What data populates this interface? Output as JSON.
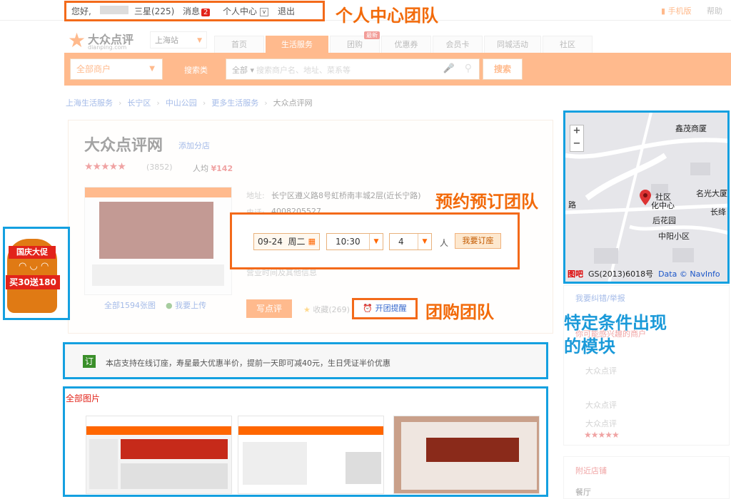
{
  "topbar": {
    "greeting": "您好,",
    "username": "       ",
    "level": "三星(225)",
    "messages_label": "消息",
    "messages_count": "2",
    "user_center": "个人中心",
    "logout": "退出",
    "mobile": "手机版",
    "help": "帮助"
  },
  "header": {
    "logo_text": "大众点评",
    "logo_sub": "dianping.com",
    "city": "上海站",
    "tabs": [
      "首页",
      "生活服务",
      "团购",
      "优惠券",
      "会员卡",
      "同城活动",
      "社区"
    ],
    "new_badge": "最新",
    "category_select": "全部商户",
    "category_label": "搜索类",
    "search_scope": "全部",
    "search_placeholder": "搜索商户名、地址、菜系等",
    "search_button": "搜索"
  },
  "breadcrumb": [
    "上海生活服务",
    "长宁区",
    "中山公园",
    "更多生活服务",
    "大众点评网"
  ],
  "shop": {
    "name": "大众点评网",
    "name_link": "添加分店",
    "stars": "★★★★★",
    "reviews": "(3852)",
    "avg_label": "人均",
    "avg_value": "¥142",
    "addr_label": "地址:",
    "addr_value": "长宁区遵义路8号虹桥南丰城2层(近长宁路)",
    "tel_label": "电话:",
    "tel_value": "4008205527",
    "more_info": "营业时间及其他信息",
    "review_button": "写点评",
    "fav": "收藏(269)",
    "photo_count": "全部1594张图",
    "upload_photo": "我要上传"
  },
  "booking": {
    "date": "09-24",
    "weekday": "周二",
    "time": "10:30",
    "people": "4",
    "people_unit": "人",
    "button": "我要订座"
  },
  "groupbuy": {
    "button": "开团提醒"
  },
  "annotations": {
    "user_center_team": "个人中心团队",
    "booking_team": "预约预订团队",
    "groupbuy_team": "团购团队",
    "conditional_modules_line1": "特定条件出现",
    "conditional_modules_line2": "的模块"
  },
  "notice": {
    "icon": "订",
    "text": "本店支持在线订座，寿星最大优惠半价，提前一天即可减40元，生日凭证半价优惠"
  },
  "photos": {
    "title": "全部图片"
  },
  "promo": {
    "line1": "国庆大促",
    "line2": "买30送180"
  },
  "map": {
    "labels": [
      "鑫茂商厦",
      "社区",
      "化中心",
      "后花园",
      "名光大厦",
      "长绛",
      "中阳小区",
      "路"
    ],
    "copyright": "GS(2013)6018号",
    "data_label": "Data ©",
    "navinfo": "NavInfo",
    "baidu": "图吧",
    "zoom_in": "+",
    "zoom_out": "−"
  },
  "right_column": {
    "report": "我要纠错/举报",
    "lines": [
      "你可能感兴趣的商户",
      "大众点评",
      "大众点评",
      "大众点评",
      "附近店铺",
      "餐厅"
    ]
  },
  "colors": {
    "brand_orange": "#ff6600",
    "annotation_orange": "#f26a0a",
    "annotation_blue": "#1b9ad9"
  }
}
